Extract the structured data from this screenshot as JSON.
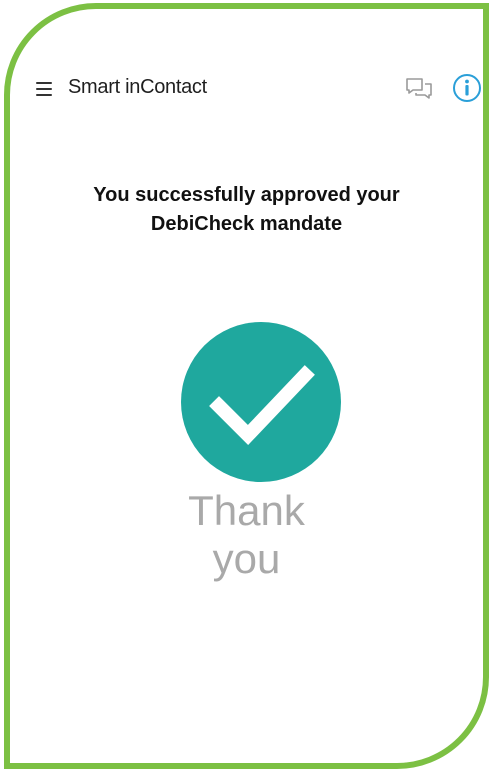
{
  "app": {
    "title": "Smart inContact"
  },
  "icons": {
    "menu": "hamburger-menu-icon",
    "chat": "chat-bubbles-icon",
    "info": "info-circle-icon",
    "success": "checkmark-circle-icon"
  },
  "main": {
    "message_line1": "You successfully approved your",
    "message_line2": "DebiCheck mandate",
    "thank_line1": "Thank",
    "thank_line2": "you"
  },
  "colors": {
    "frame_border": "#7cc043",
    "success_circle": "#1fa89e",
    "info_accent": "#2a9fd8",
    "thank_text": "#a9a9a9"
  }
}
